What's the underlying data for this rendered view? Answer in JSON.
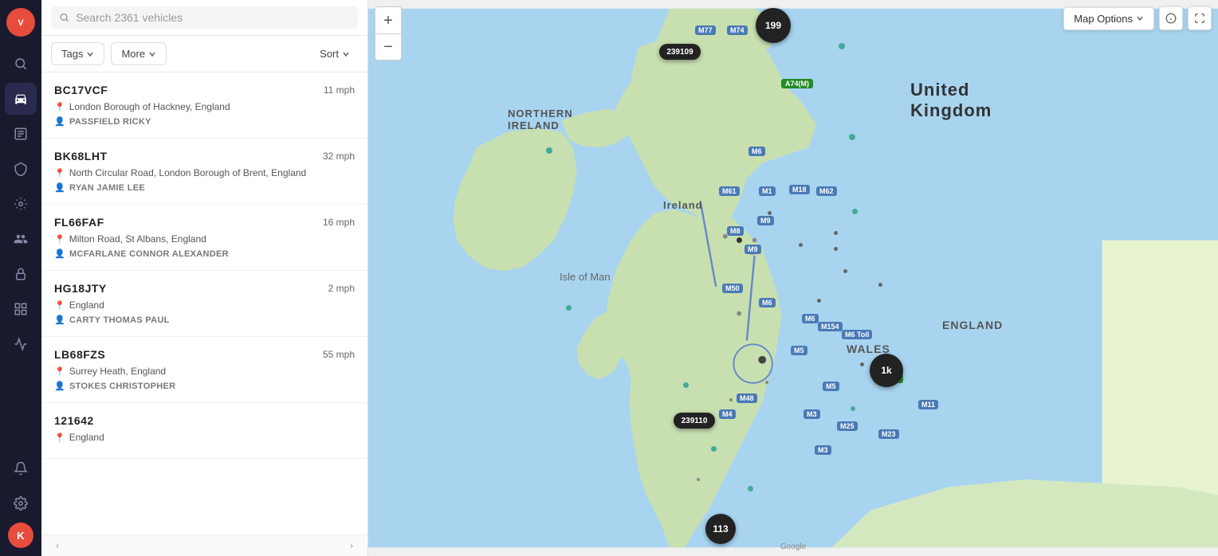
{
  "app": {
    "logo_letter": "V",
    "avatar_letter": "K"
  },
  "sidebar": {
    "icons": [
      {
        "name": "search-icon",
        "symbol": "🔍",
        "label": "Search"
      },
      {
        "name": "vehicles-icon",
        "symbol": "🚗",
        "label": "Vehicles",
        "active": true
      },
      {
        "name": "reports-icon",
        "symbol": "📋",
        "label": "Reports"
      },
      {
        "name": "shield-icon",
        "symbol": "🛡",
        "label": "Security"
      },
      {
        "name": "tools-icon",
        "symbol": "🔧",
        "label": "Tools"
      },
      {
        "name": "group-icon",
        "symbol": "👥",
        "label": "Groups"
      },
      {
        "name": "lock-icon",
        "symbol": "🔒",
        "label": "Lock"
      },
      {
        "name": "grid-icon",
        "symbol": "⚡",
        "label": "Grid"
      },
      {
        "name": "chart-icon",
        "symbol": "📊",
        "label": "Chart"
      },
      {
        "name": "settings-icon",
        "symbol": "⚙",
        "label": "Settings"
      }
    ]
  },
  "search": {
    "placeholder": "Search 2361 vehicles",
    "value": ""
  },
  "filters": {
    "tags_label": "Tags",
    "more_label": "More",
    "sort_label": "Sort"
  },
  "vehicles": [
    {
      "plate": "BC17VCF",
      "speed": "11 mph",
      "location": "London Borough of Hackney, England",
      "driver": "PASSFIELD RICKY"
    },
    {
      "plate": "BK68LHT",
      "speed": "32 mph",
      "location": "North Circular Road, London Borough of Brent, England",
      "driver": "RYAN JAMIE LEE"
    },
    {
      "plate": "FL66FAF",
      "speed": "16 mph",
      "location": "Milton Road, St Albans, England",
      "driver": "MCFARLANE CONNOR ALEXANDER"
    },
    {
      "plate": "HG18JTY",
      "speed": "2 mph",
      "location": "England",
      "driver": "CARTY THOMAS PAUL"
    },
    {
      "plate": "LB68FZS",
      "speed": "55 mph",
      "location": "Surrey Heath, England",
      "driver": "STOKES CHRISTOPHER"
    },
    {
      "plate": "121642",
      "speed": "",
      "location": "England",
      "driver": ""
    }
  ],
  "map": {
    "options_label": "Map Options",
    "clusters": [
      {
        "id": "c1",
        "count": "199",
        "top": "28",
        "left": "495",
        "size": "44"
      },
      {
        "id": "c2",
        "count": "239109",
        "top": "52",
        "left": "372",
        "size": "52"
      },
      {
        "id": "c3",
        "count": "1k",
        "top": "432",
        "left": "648",
        "size": "42"
      },
      {
        "id": "c4",
        "count": "239110",
        "top": "510",
        "left": "383",
        "size": "52"
      },
      {
        "id": "c5",
        "count": "113",
        "top": "638",
        "left": "424",
        "size": "38"
      }
    ]
  }
}
